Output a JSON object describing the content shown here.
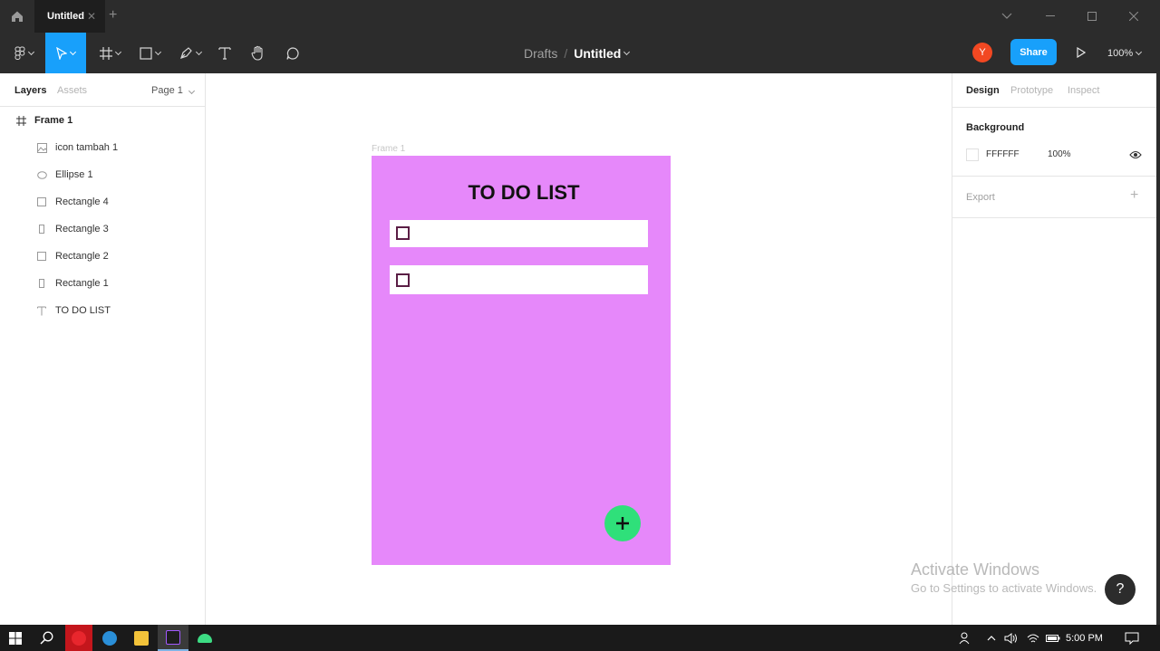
{
  "titlebar": {
    "tab_title": "Untitled",
    "tab_close": "✕",
    "new_tab": "+"
  },
  "toolbar": {
    "breadcrumb_team": "Drafts",
    "breadcrumb_sep": "/",
    "breadcrumb_file": "Untitled",
    "avatar_initial": "Y",
    "share_label": "Share",
    "zoom": "100%"
  },
  "left_panel": {
    "tabs": [
      "Layers",
      "Assets"
    ],
    "page_selector": "Page 1",
    "layers": [
      {
        "name": "Frame 1",
        "icon": "frame-icon"
      },
      {
        "name": "icon tambah 1",
        "icon": "image-icon"
      },
      {
        "name": "Ellipse 1",
        "icon": "ellipse-icon"
      },
      {
        "name": "Rectangle 4",
        "icon": "rectangle-icon"
      },
      {
        "name": "Rectangle 3",
        "icon": "rectangle-vertical-icon"
      },
      {
        "name": "Rectangle 2",
        "icon": "rectangle-icon"
      },
      {
        "name": "Rectangle 1",
        "icon": "rectangle-vertical-icon"
      },
      {
        "name": "TO DO LIST",
        "icon": "text-icon"
      }
    ]
  },
  "canvas": {
    "frame_label": "Frame 1",
    "frame_title": "TO DO LIST",
    "frame_color": "#e688fa",
    "add_button_color": "#2fe07a",
    "add_button_glyph": "+"
  },
  "right_panel": {
    "tabs": [
      "Design",
      "Prototype",
      "Inspect"
    ],
    "background_title": "Background",
    "background_hex": "FFFFFF",
    "background_opacity": "100%",
    "export_title": "Export",
    "export_add": "+"
  },
  "watermark": {
    "line1": "Activate Windows",
    "line2": "Go to Settings to activate Windows."
  },
  "help_glyph": "?",
  "taskbar": {
    "clock": "5:00 PM"
  },
  "colors": {
    "accent": "#18a0fb",
    "toolbar_bg": "#2c2c2c"
  }
}
